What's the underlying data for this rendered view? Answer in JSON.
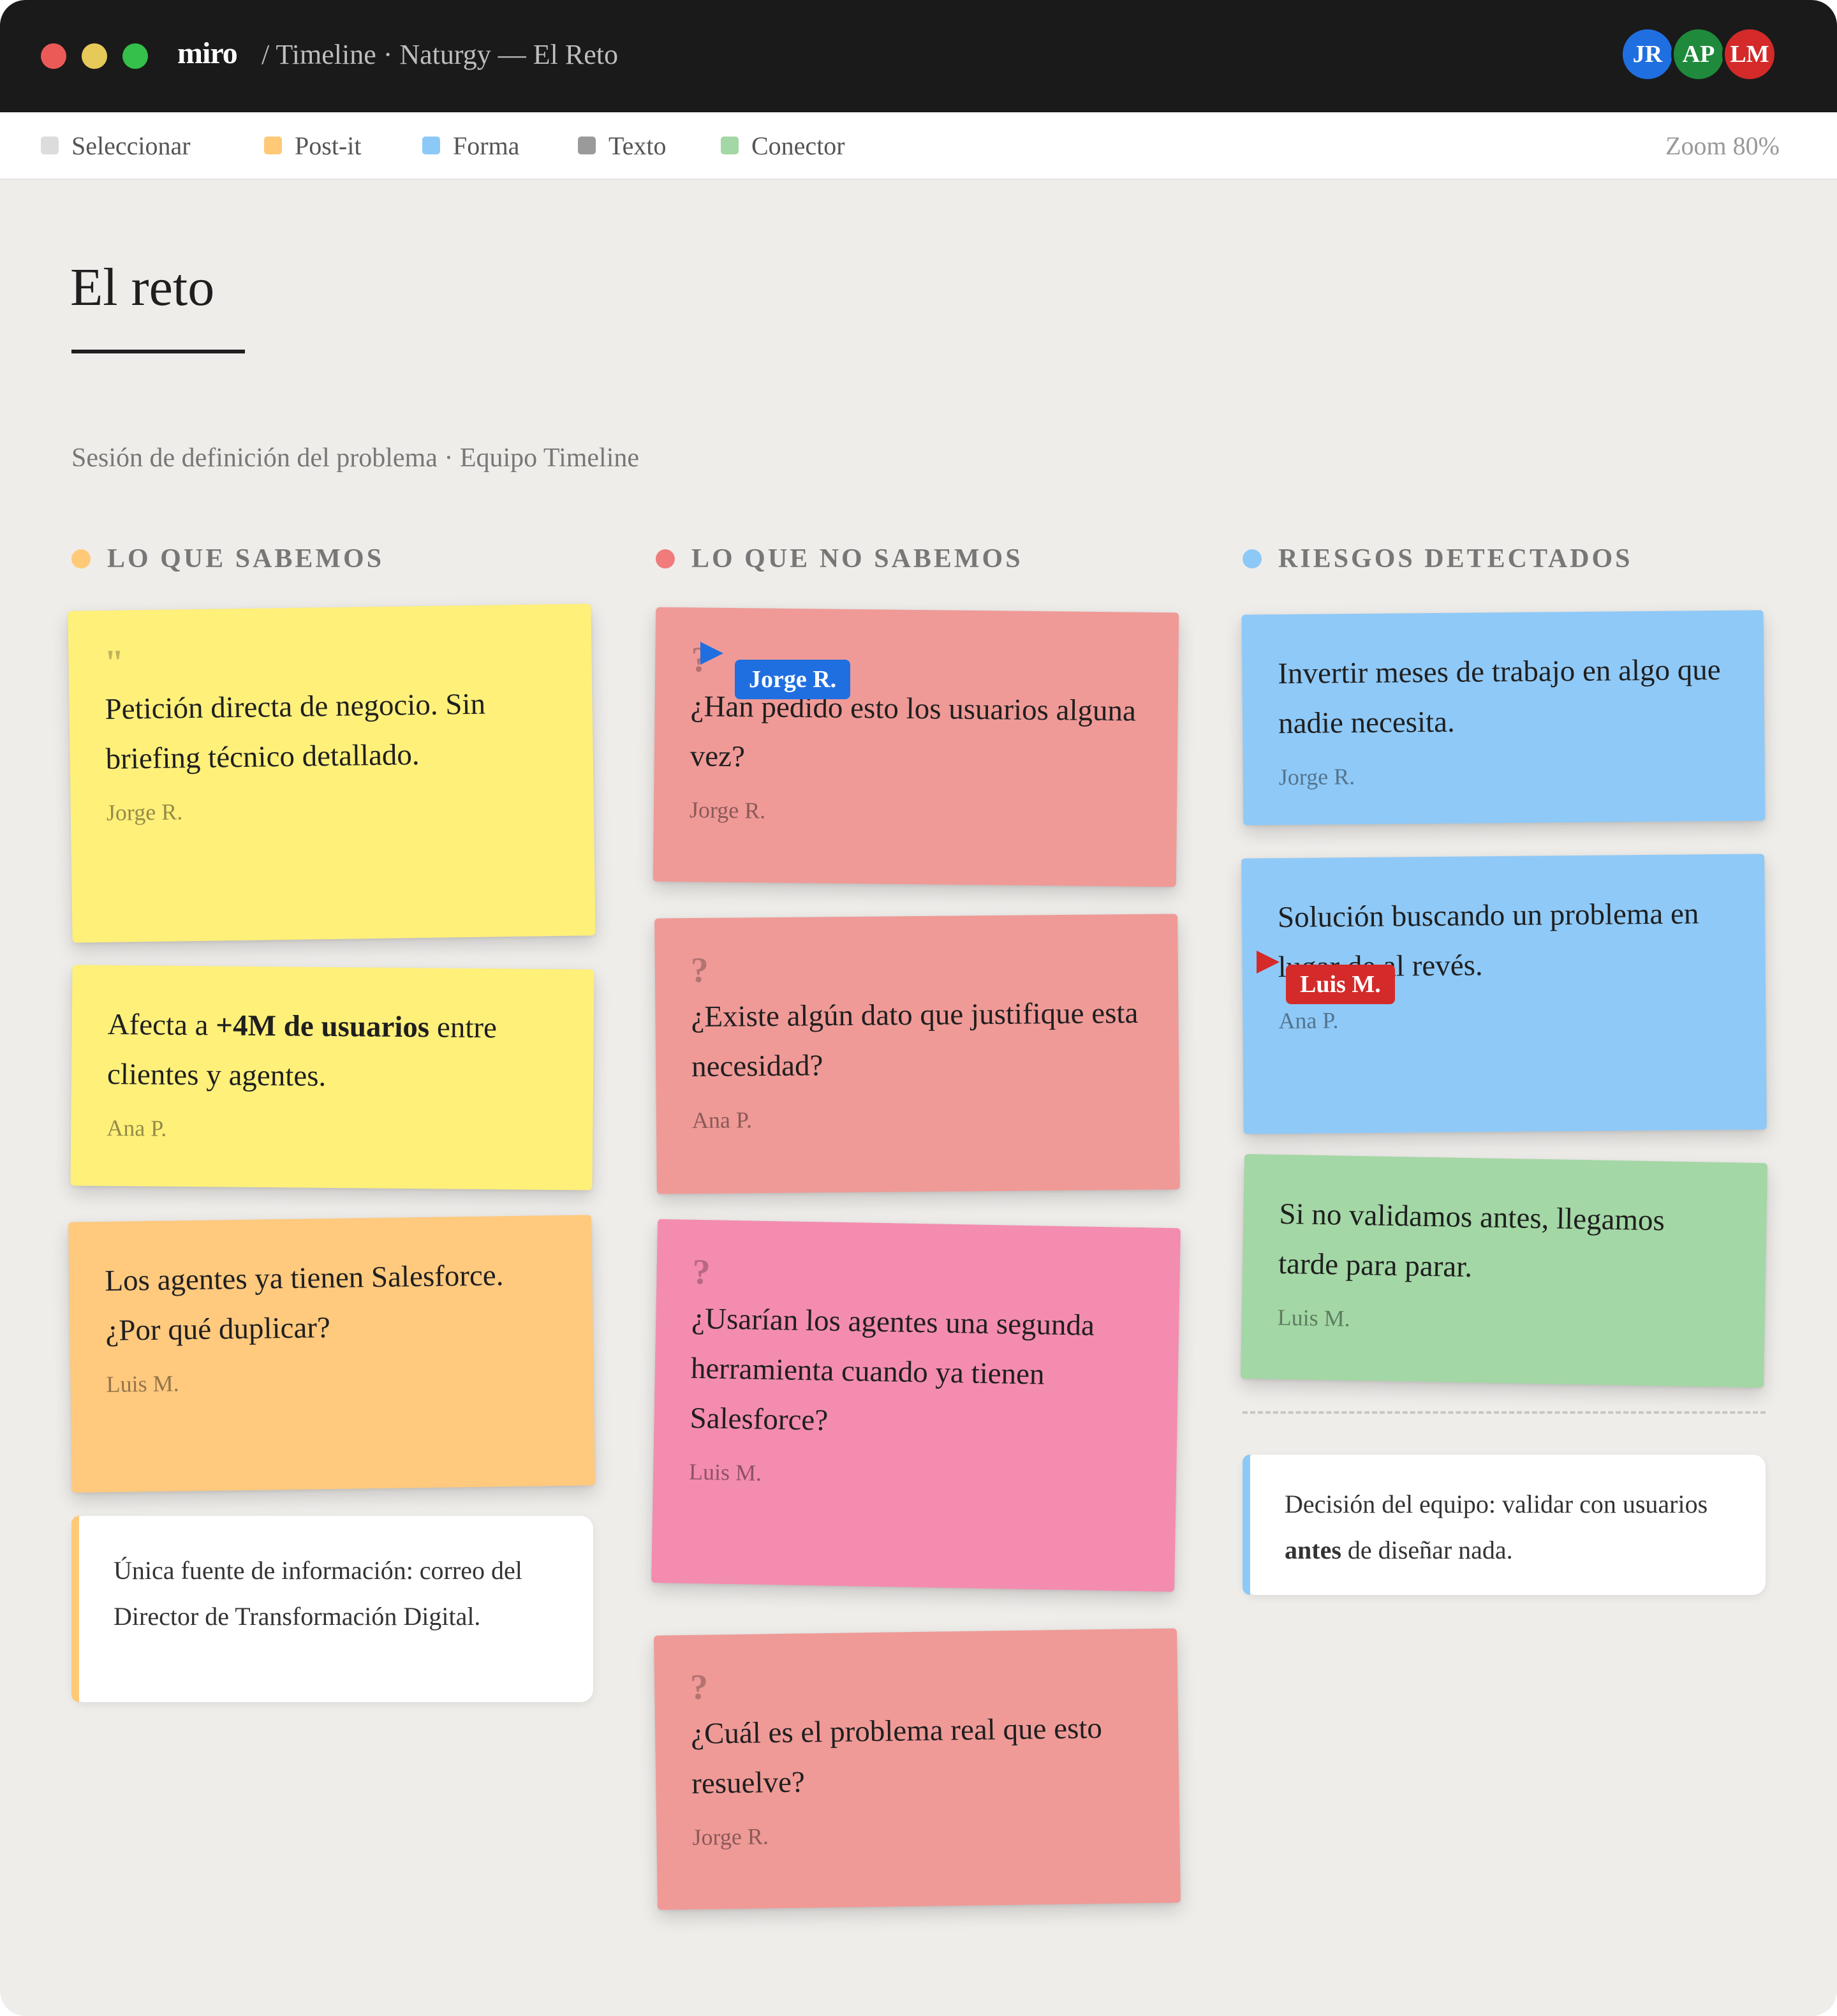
{
  "app": {
    "brand": "miro",
    "breadcrumb": "/ Timeline · Naturgy — El Reto",
    "avatars": [
      {
        "initials": "JR",
        "color": "#1f6fe0"
      },
      {
        "initials": "AP",
        "color": "#1f8a3b"
      },
      {
        "initials": "LM",
        "color": "#d42a2a"
      }
    ]
  },
  "toolbar": {
    "tools": [
      {
        "label": "Seleccionar",
        "color": "#dcdcdc"
      },
      {
        "label": "Post-it",
        "color": "#ffc978"
      },
      {
        "label": "Forma",
        "color": "#8dc9f7"
      },
      {
        "label": "Texto",
        "color": "#9a9a9a"
      },
      {
        "label": "Conector",
        "color": "#a3d7a5"
      }
    ],
    "zoom": "Zoom 80%"
  },
  "board": {
    "title": "El reto",
    "subtitle": "Sesión de definición del problema · Equipo Timeline",
    "columns": [
      {
        "label": "LO QUE SABEMOS",
        "color": "#ffc978"
      },
      {
        "label": "LO QUE NO SABEMOS",
        "color": "#ef7b7b"
      },
      {
        "label": "RIESGOS DETECTADOS",
        "color": "#8dc9f7"
      }
    ],
    "known": [
      {
        "glyph": "\"",
        "text": "Petición directa de negocio. Sin briefing técnico detallado.",
        "author": "Jorge R."
      },
      {
        "text_pre": "Afecta a ",
        "text_bold": "+4M de usuarios",
        "text_post": " entre clientes y agentes.",
        "author": "Ana P."
      },
      {
        "text": "Los agentes ya tienen Salesforce. ¿Por qué duplicar?",
        "author": "Luis M."
      }
    ],
    "known_note": "Única fuente de información: correo del Director de Transformación Digital.",
    "unknown": [
      {
        "glyph": "?",
        "text": "¿Han pedido esto los usuarios alguna vez?",
        "author": "Jorge R."
      },
      {
        "glyph": "?",
        "text": "¿Existe algún dato que justifique esta necesidad?",
        "author": "Ana P."
      },
      {
        "glyph": "?",
        "text": "¿Usarían los agentes una segunda herramienta cuando ya tienen Salesforce?",
        "author": "Luis M."
      },
      {
        "glyph": "?",
        "text": "¿Cuál es el problema real que esto resuelve?",
        "author": "Jorge R."
      }
    ],
    "risks": [
      {
        "text": "Invertir meses de trabajo en algo que nadie necesita.",
        "author": "Jorge R."
      },
      {
        "text": "Solución buscando un problema en lugar de al revés.",
        "author": "Ana P."
      },
      {
        "text": "Si no validamos antes, llegamos tarde para parar.",
        "author": "Luis M."
      }
    ],
    "decision": {
      "pre": "Decisión del equipo: validar con usuarios ",
      "bold": "antes",
      "post": " de diseñar nada."
    },
    "colors": {
      "yellow": "#fff07a",
      "orange": "#ffc97e",
      "red": "#ef9a97",
      "pink": "#f48cb0",
      "blue": "#8fc9f7",
      "green": "#a3d7a5"
    }
  },
  "cursors": [
    {
      "name": "Jorge R.",
      "color": "#1f6fe0"
    },
    {
      "name": "Luis M.",
      "color": "#d42a2a"
    }
  ]
}
